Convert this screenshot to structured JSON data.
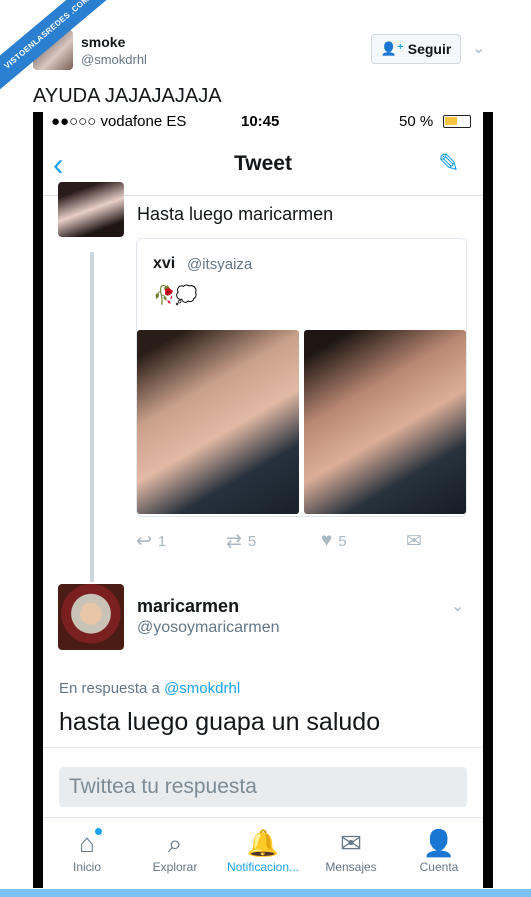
{
  "watermark": {
    "text": "VISTOENLASREDES .COM"
  },
  "embed": {
    "name": "smoke",
    "handle": "@smokdrhl",
    "follow_label": "Seguir",
    "tweet_text": "AYUDA JAJAJAJAJA"
  },
  "status_bar": {
    "carrier": "●●○○○ vodafone ES",
    "time": "10:45",
    "battery": "50 %",
    "battery_level": 0.5
  },
  "nav": {
    "title": "Tweet"
  },
  "reply_tweet": {
    "text": "Hasta luego maricarmen",
    "quote": {
      "name": "xvi",
      "handle": "@itsyaiza",
      "emojis": "🥀💭"
    },
    "actions": {
      "replies": "1",
      "retweets": "5",
      "likes": "5"
    }
  },
  "main_tweet": {
    "name": "maricarmen",
    "handle": "@yosoymaricarmen",
    "in_reply_prefix": "En respuesta a",
    "in_reply_mention": "@smokdrhl",
    "text": "hasta luego  guapa un saludo"
  },
  "reply_box": {
    "placeholder": "Twittea tu respuesta"
  },
  "tabs": [
    {
      "label": "Inicio",
      "icon": "home-icon"
    },
    {
      "label": "Explorar",
      "icon": "search-icon"
    },
    {
      "label": "Notificacion...",
      "icon": "bell-icon"
    },
    {
      "label": "Mensajes",
      "icon": "envelope-icon"
    },
    {
      "label": "Cuenta",
      "icon": "person-icon"
    }
  ],
  "colors": {
    "accent": "#1da1f2",
    "muted": "#657786"
  }
}
